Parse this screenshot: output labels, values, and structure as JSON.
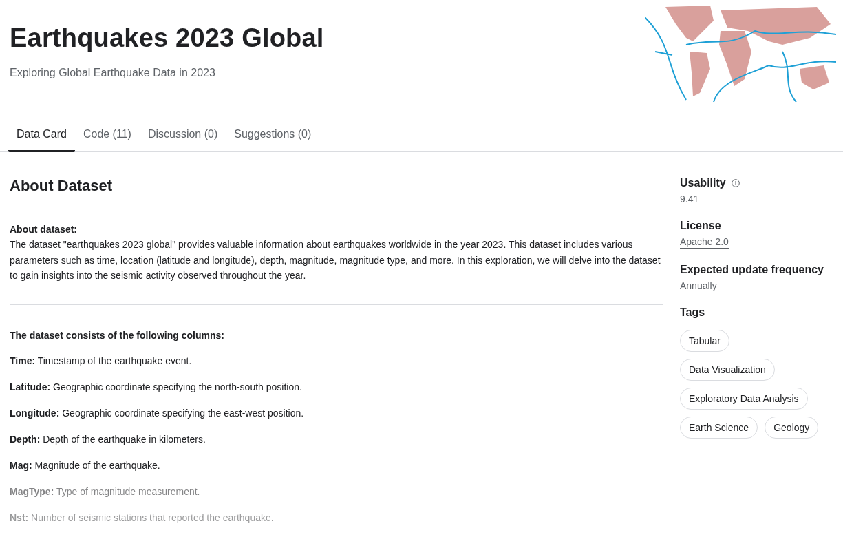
{
  "header": {
    "title": "Earthquakes 2023 Global",
    "subtitle": "Exploring Global Earthquake Data in 2023"
  },
  "tabs": [
    {
      "label": "Data Card",
      "selected": true
    },
    {
      "label": "Code (11)",
      "selected": false
    },
    {
      "label": "Discussion (0)",
      "selected": false
    },
    {
      "label": "Suggestions (0)",
      "selected": false
    }
  ],
  "about": {
    "heading": "About Dataset",
    "intro_title": "About dataset:",
    "intro": "The dataset \"earthquakes 2023 global\" provides valuable information about earthquakes worldwide in the year 2023. This dataset includes various parameters such as time, location (latitude and longitude), depth, magnitude, magnitude type, and more. In this exploration, we will delve into the dataset to gain insights into the seismic activity observed throughout the year.",
    "columns_title": "The dataset consists of the following columns:",
    "collapsed": true,
    "columns": [
      {
        "text": "**Time:** Timestamp of the earthquake event."
      },
      {
        "text": "**Latitude:** Geographic coordinate specifying the north-south position."
      },
      {
        "text": "**Longitude:** Geographic coordinate specifying the east-west position."
      },
      {
        "text": "**Depth:** Depth of the earthquake in kilometers."
      },
      {
        "text": "**Mag:** Magnitude of the earthquake."
      },
      {
        "text": "**MagType:** Type of magnitude measurement."
      },
      {
        "text": "**Nst:** Number of seismic stations that reported the earthquake."
      }
    ]
  },
  "sidebar": {
    "usability": {
      "label": "Usability",
      "value": "9.41"
    },
    "license": {
      "label": "License",
      "value": "Apache 2.0"
    },
    "frequency": {
      "label": "Expected update frequency",
      "value": "Annually"
    },
    "tags_label": "Tags",
    "tags": [
      "Tabular",
      "Data Visualization",
      "Exploratory Data Analysis",
      "Earth Science",
      "Geology"
    ]
  }
}
